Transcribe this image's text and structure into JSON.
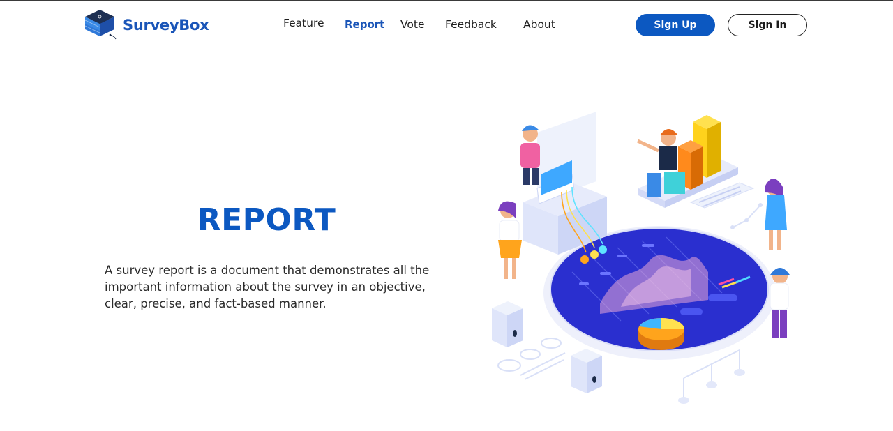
{
  "brand": {
    "name": "SurveyBox",
    "logo_icon": "server-stack-icon"
  },
  "nav": {
    "items": [
      {
        "label": "Feature",
        "active": false
      },
      {
        "label": "Report",
        "active": true
      },
      {
        "label": "Vote",
        "active": false
      },
      {
        "label": "Feedback",
        "active": false
      },
      {
        "label": "About",
        "active": false
      }
    ]
  },
  "auth": {
    "signup_label": "Sign Up",
    "signin_label": "Sign In"
  },
  "hero": {
    "title": "REPORT",
    "description": "A survey report is a document that demonstrates all the important information about the survey in an objective, clear, precise, and fact-based manner."
  },
  "colors": {
    "primary": "#0c58c1",
    "brand_text": "#1a55b8",
    "illustration_disc": "#2a2fcf"
  }
}
